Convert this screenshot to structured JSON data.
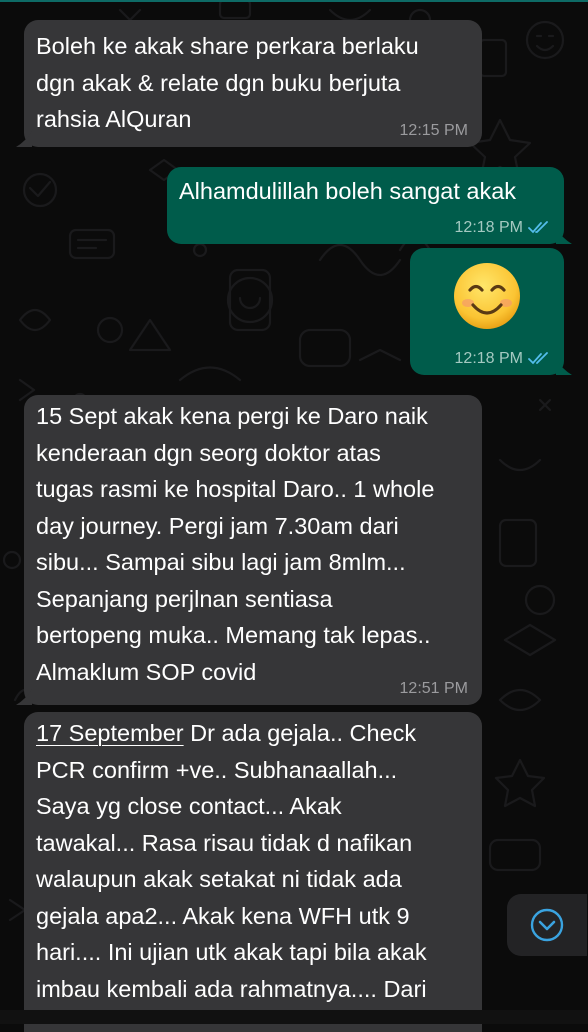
{
  "messages": [
    {
      "direction": "incoming",
      "text": "Boleh ke akak share perkara berlaku\ndgn akak & relate dgn buku berjuta\nrahsia AlQuran",
      "time": "12:15 PM"
    },
    {
      "direction": "outgoing",
      "text": "Alhamdulillah boleh sangat akak",
      "time": "12:18 PM",
      "status": "read"
    },
    {
      "direction": "outgoing",
      "emoji": "smiling-face-emoji",
      "time": "12:18 PM",
      "status": "read"
    },
    {
      "direction": "incoming",
      "text": "15 Sept akak kena pergi ke Daro naik\nkenderaan dgn seorg doktor atas\ntugas rasmi ke hospital Daro.. 1 whole\nday journey. Pergi jam 7.30am dari\nsibu... Sampai sibu lagi jam 8mlm...\nSepanjang perjlnan sentiasa\nbertopeng muka.. Memang tak lepas..\nAlmaklum SOP covid",
      "time": "12:51 PM"
    },
    {
      "direction": "incoming",
      "date_link": "17 September",
      "text": " Dr ada gejala.. Check\nPCR confirm +ve.. Subhanaallah...\nSaya yg close contact... Akak\ntawakal... Rasa risau tidak d nafikan\nwalaupun akak setakat ni tidak ada\ngejala apa2... Akak kena WFH utk 9\nhari.... Ini ujian utk akak tapi bila akak\nimbau kembali ada rahmatnya.... Dari"
    }
  ],
  "scroll_button": {
    "icon": "chevron-down-icon"
  },
  "colors": {
    "incoming": "#363638",
    "outgoing": "#005c4b",
    "read_tick": "#53bdeb",
    "background": "#0b0b0b"
  }
}
